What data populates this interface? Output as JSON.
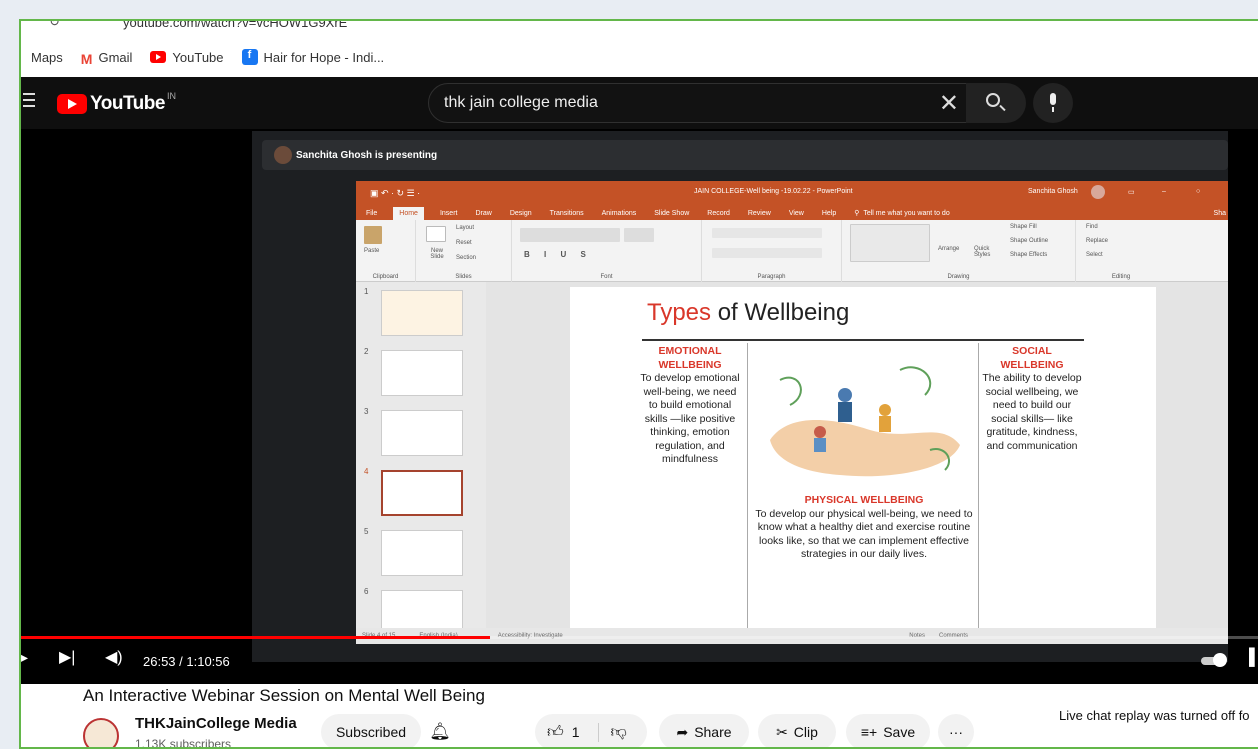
{
  "browser": {
    "url": "youtube.com/watch?v=vcHOW1G9XrE",
    "bookmarks": [
      {
        "label": "Maps",
        "icon": "maps-icon"
      },
      {
        "label": "Gmail",
        "icon": "gmail-icon",
        "color": "#ea4335"
      },
      {
        "label": "YouTube",
        "icon": "youtube-icon",
        "color": "#ff0000"
      },
      {
        "label": "Hair for Hope - Indi...",
        "icon": "facebook-icon",
        "color": "#1877f2"
      }
    ]
  },
  "youtube": {
    "logo_text": "YouTube",
    "region": "IN",
    "search_query": "thk jain college media"
  },
  "meet": {
    "presenting_text": "Sanchita Ghosh is presenting"
  },
  "powerpoint": {
    "window_title": "JAIN COLLEGE-Well being -19.02.22  -  PowerPoint",
    "user": "Sanchita Ghosh",
    "tabs": [
      "File",
      "Home",
      "Insert",
      "Draw",
      "Design",
      "Transitions",
      "Animations",
      "Slide Show",
      "Record",
      "Review",
      "View",
      "Help"
    ],
    "tell_me": "Tell me what you want to do",
    "share": "Sha",
    "ribbon_groups": [
      "Clipboard",
      "Slides",
      "Font",
      "Paragraph",
      "Drawing",
      "Editing"
    ],
    "ribbon_buttons": {
      "paste": "Paste",
      "new_slide": "New Slide",
      "layout": "Layout",
      "reset": "Reset",
      "section": "Section",
      "arrange": "Arrange",
      "quick_styles": "Quick Styles",
      "shape_fill": "Shape Fill",
      "shape_outline": "Shape Outline",
      "shape_effects": "Shape Effects",
      "find": "Find",
      "replace": "Replace",
      "select": "Select"
    },
    "slide_numbers": [
      "1",
      "2",
      "3",
      "4",
      "5",
      "6"
    ],
    "status": {
      "slide_of": "Slide 4 of 15",
      "language": "English (India)",
      "accessibility": "Accessibility: Investigate",
      "notes": "Notes",
      "comments": "Comments"
    },
    "slide": {
      "title_red": "Types",
      "title_rest": " of Wellbeing",
      "emotional_heading": "EMOTIONAL WELLBEING",
      "emotional_text": "To develop emotional well-being, we need to build emotional skills —like positive thinking, emotion regulation, and mindfulness",
      "physical_heading": "PHYSICAL WELLBEING",
      "physical_text": "To develop our physical well-being, we need to know what a healthy diet and exercise routine looks like, so that we can implement effective strategies in our daily lives.",
      "social_heading": "SOCIAL WELLBEING",
      "social_text": "The ability to develop social wellbeing, we need to build our social skills— like gratitude, kindness, and communication"
    }
  },
  "player": {
    "time": "26:53 / 1:10:56",
    "progress": 0.379
  },
  "video": {
    "title": "An Interactive Webinar Session on Mental Well Being",
    "channel": "THKJainCollege Media",
    "subscribers": "1.13K subscribers",
    "subscribed_label": "Subscribed",
    "likes": "1",
    "share_label": "Share",
    "clip_label": "Clip",
    "save_label": "Save",
    "chat_note": "Live chat replay was turned off fo"
  }
}
